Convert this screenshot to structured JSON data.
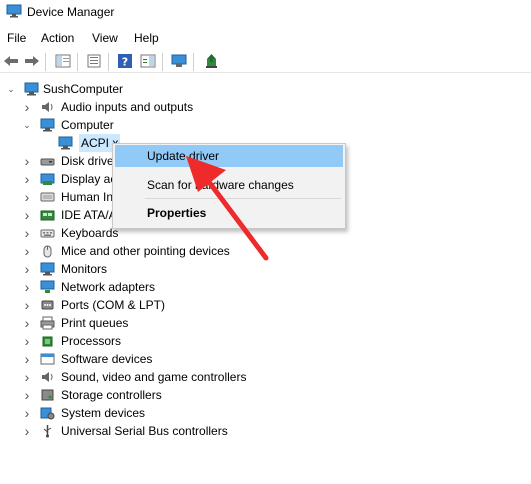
{
  "window": {
    "title": "Device Manager"
  },
  "menu": [
    "File",
    "Action",
    "View",
    "Help"
  ],
  "tree": {
    "root": "SushComputer",
    "items": [
      {
        "label": "Audio inputs and outputs",
        "icon": "speaker-icon"
      },
      {
        "label": "Computer",
        "icon": "monitor-icon",
        "expanded": true
      },
      {
        "label": "ACPI x64-based PC",
        "icon": "monitor-icon",
        "child": true,
        "visible_label": "ACPI x"
      },
      {
        "label": "Disk drives",
        "icon": "disk-drive-icon",
        "visible_label": "Disk drive"
      },
      {
        "label": "Display adapters",
        "icon": "display-adapter-icon",
        "visible_label": "Display ac"
      },
      {
        "label": "Human Interface Devices",
        "icon": "hid-icon",
        "visible_label": "Human In"
      },
      {
        "label": "IDE ATA/ATAPI controllers",
        "icon": "ide-controller-icon",
        "visible_label": "IDE ATA/A"
      },
      {
        "label": "Keyboards",
        "icon": "keyboard-icon"
      },
      {
        "label": "Mice and other pointing devices",
        "icon": "mouse-icon"
      },
      {
        "label": "Monitors",
        "icon": "monitor-icon"
      },
      {
        "label": "Network adapters",
        "icon": "network-icon"
      },
      {
        "label": "Ports (COM & LPT)",
        "icon": "port-icon"
      },
      {
        "label": "Print queues",
        "icon": "printer-icon"
      },
      {
        "label": "Processors",
        "icon": "processor-icon"
      },
      {
        "label": "Software devices",
        "icon": "software-device-icon"
      },
      {
        "label": "Sound, video and game controllers",
        "icon": "speaker-icon"
      },
      {
        "label": "Storage controllers",
        "icon": "storage-icon"
      },
      {
        "label": "System devices",
        "icon": "system-device-icon"
      },
      {
        "label": "Universal Serial Bus controllers",
        "icon": "usb-icon"
      }
    ]
  },
  "context_menu": {
    "items": [
      "Update driver",
      "Scan for hardware changes",
      "Properties"
    ],
    "highlighted": "Update driver"
  },
  "colors": {
    "highlight": "#91c9f7",
    "selection": "#cce8ff",
    "arrow": "#ee2a2a"
  }
}
